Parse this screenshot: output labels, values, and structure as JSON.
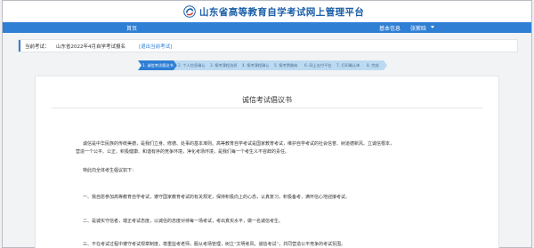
{
  "header": {
    "title": "山东省高等教育自学考试网上管理平台",
    "logo_icon": "swirl-logo-icon"
  },
  "nav": {
    "home": "首页",
    "info": "基本信息",
    "user": "张紫晗",
    "user_caret_icon": "chevron-down-icon"
  },
  "exam": {
    "label": "当前考试：",
    "name": "山东省2022年4月自学考试报名",
    "link": "[退出当前考试]"
  },
  "steps": [
    "1. 诚信考试倡议书",
    "2. 个人信息确认",
    "3. 报考课程选择",
    "4. 报考课程确认",
    "5. 报考费缴纳",
    "6. 网上支付平台",
    "7. 打印确认单",
    "8. 完成"
  ],
  "document": {
    "title": "诚信考试倡议书",
    "paragraphs": [
      "诚信是中华民族的传统美德，是我们立身、修德、处事的基本准则。高等教育自学考试是国家教育考试，维护自学考试的社会信誉、树道德新风、立诚信根本，",
      "营造一个公平、公正、积极健康、和谐有序的竞争环境，净化考场环境，是我们每一个考生义不容辞的责任。",
      "特此向全体考生倡议如下：",
      "一、我自愿参加高等教育自学考试，遵守国家教育考试的有关规定，保持积极向上的心态，认真复习，积极备考，满怀信心地迎接考试。",
      "二、是诚实守信者，端正考试态度，以诚信的态度对待每一场考试，考出真实水平，做一名诚信考生。",
      "三、不在考试过程中遵守考试规章制度，尊重监考老师，服从考场管理，树立“文明考风，诚信考试”，共同营造公平竞争的考试氛围。"
    ]
  },
  "colors": {
    "brand_blue": "#2f7fd5",
    "title_blue": "#1b5fa8",
    "step_inactive": "#bcd9f2"
  }
}
